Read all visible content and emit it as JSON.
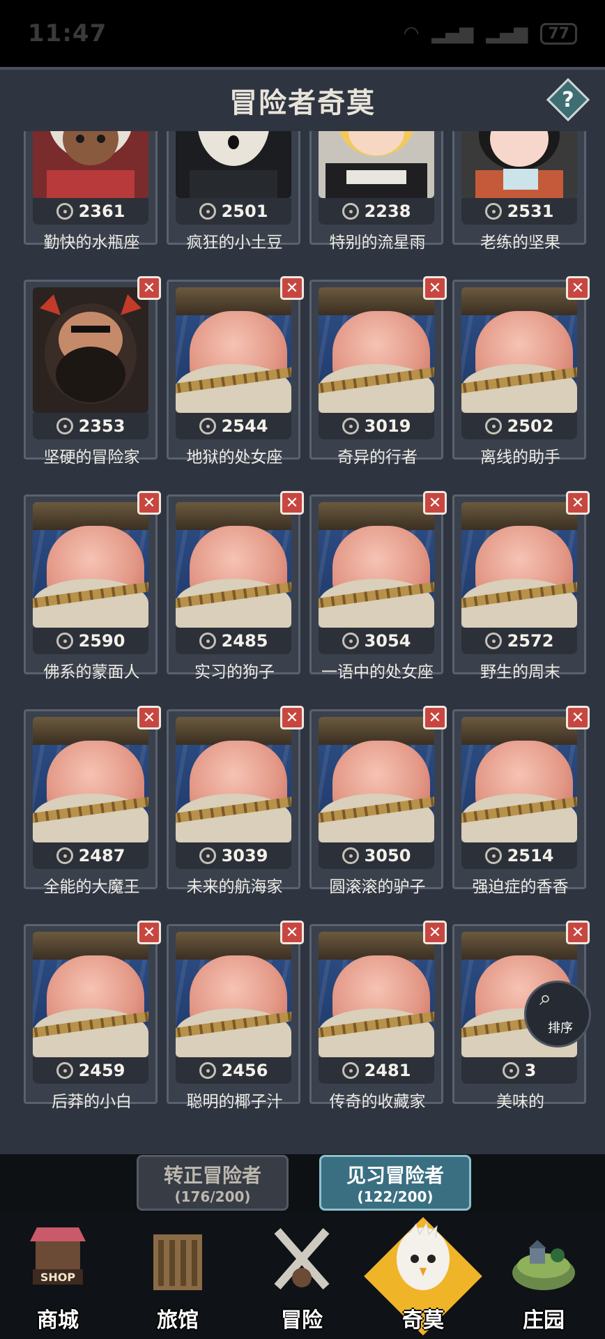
{
  "status_bar": {
    "time": "11:47",
    "battery": "77"
  },
  "header": {
    "title": "冒险者奇莫",
    "help_label": "?"
  },
  "cards": [
    {
      "name": "勤快的水瓶座",
      "score": "2361",
      "type": "target",
      "removable": false,
      "portrait": "white-hair-girl"
    },
    {
      "name": "疯狂的小土豆",
      "score": "2501",
      "type": "target",
      "removable": false,
      "portrait": "masked-figure"
    },
    {
      "name": "特别的流星雨",
      "score": "2238",
      "type": "target",
      "removable": false,
      "portrait": "blonde-hoodie"
    },
    {
      "name": "老练的坚果",
      "score": "2531",
      "type": "target",
      "removable": false,
      "portrait": "black-hair-girl"
    },
    {
      "name": "坚硬的冒险家",
      "score": "2353",
      "type": "target",
      "removable": true,
      "portrait": "bearded-beast"
    },
    {
      "name": "地狱的处女座",
      "score": "2544",
      "type": "sword",
      "removable": true,
      "portrait": "pig-knight"
    },
    {
      "name": "奇异的行者",
      "score": "3019",
      "type": "sword",
      "removable": true,
      "portrait": "pig-knight"
    },
    {
      "name": "离线的助手",
      "score": "2502",
      "type": "sword",
      "removable": true,
      "portrait": "pig-knight"
    },
    {
      "name": "佛系的蒙面人",
      "score": "2590",
      "type": "sword",
      "removable": true,
      "portrait": "pig-knight"
    },
    {
      "name": "实习的狗子",
      "score": "2485",
      "type": "sword",
      "removable": true,
      "portrait": "pig-knight"
    },
    {
      "name": "一语中的处女座",
      "score": "3054",
      "type": "sword",
      "removable": true,
      "portrait": "pig-knight"
    },
    {
      "name": "野生的周末",
      "score": "2572",
      "type": "sword",
      "removable": true,
      "portrait": "pig-knight"
    },
    {
      "name": "全能的大魔王",
      "score": "2487",
      "type": "sword",
      "removable": true,
      "portrait": "pig-knight"
    },
    {
      "name": "未来的航海家",
      "score": "3039",
      "type": "sword",
      "removable": true,
      "portrait": "pig-knight"
    },
    {
      "name": "圆滚滚的驴子",
      "score": "3050",
      "type": "sword",
      "removable": true,
      "portrait": "pig-knight"
    },
    {
      "name": "强迫症的香香",
      "score": "2514",
      "type": "sword",
      "removable": true,
      "portrait": "pig-knight"
    },
    {
      "name": "后莽的小白",
      "score": "2459",
      "type": "sword",
      "removable": true,
      "portrait": "pig-knight"
    },
    {
      "name": "聪明的椰子汁",
      "score": "2456",
      "type": "sword",
      "removable": true,
      "portrait": "pig-knight"
    },
    {
      "name": "传奇的收藏家",
      "score": "2481",
      "type": "sword",
      "removable": true,
      "portrait": "pig-knight"
    },
    {
      "name": "美味的",
      "score": "3",
      "type": "sword",
      "removable": true,
      "portrait": "pig-knight"
    }
  ],
  "remove_glyph": "✕",
  "sort_button": {
    "label": "排序"
  },
  "tabs": [
    {
      "label": "转正冒险者",
      "count": "(176/200)",
      "active": false
    },
    {
      "label": "见习冒险者",
      "count": "(122/200)",
      "active": true
    }
  ],
  "nav": [
    {
      "label": "商城",
      "icon": "shop-icon",
      "active": false
    },
    {
      "label": "旅馆",
      "icon": "inn-icon",
      "active": false
    },
    {
      "label": "冒险",
      "icon": "adventure-icon",
      "active": false
    },
    {
      "label": "奇莫",
      "icon": "qimo-icon",
      "active": true
    },
    {
      "label": "庄园",
      "icon": "manor-icon",
      "active": false
    }
  ],
  "shop_sign": "SHOP",
  "colors": {
    "panel": "#2f3540",
    "remove": "#c74740",
    "active_tab": "#3a6f82",
    "nav_active": "#f0b428"
  }
}
